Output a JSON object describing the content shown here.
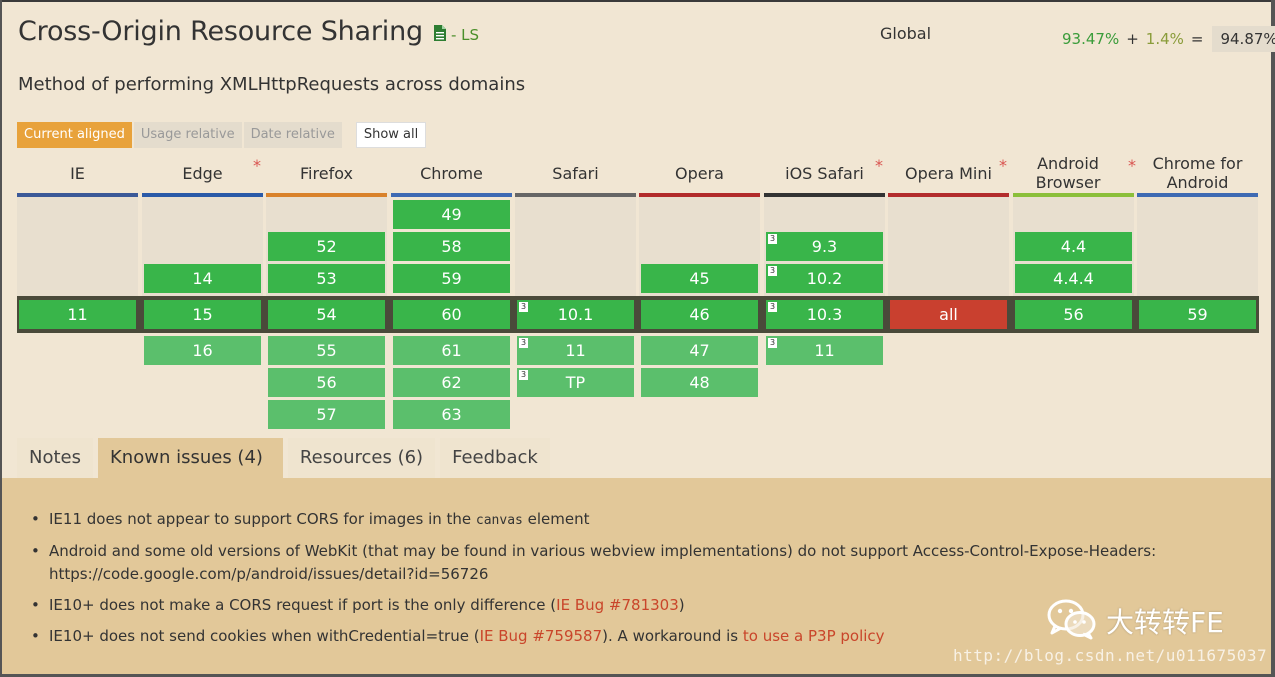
{
  "header": {
    "title": "Cross-Origin Resource Sharing",
    "spec_badge": "- LS",
    "description": "Method of performing XMLHttpRequests across domains"
  },
  "usage": {
    "scope": "Global",
    "full": "93.47%",
    "plus": "+",
    "partial": "1.4%",
    "equals": "=",
    "total": "94.87%"
  },
  "modes": {
    "current": "Current aligned",
    "usage": "Usage relative",
    "date": "Date relative",
    "show_all": "Show all"
  },
  "browsers": [
    {
      "name": "IE",
      "asterisk": ""
    },
    {
      "name": "Edge",
      "asterisk": "*"
    },
    {
      "name": "Firefox",
      "asterisk": ""
    },
    {
      "name": "Chrome",
      "asterisk": ""
    },
    {
      "name": "Safari",
      "asterisk": ""
    },
    {
      "name": "Opera",
      "asterisk": ""
    },
    {
      "name": "iOS Safari",
      "asterisk": "*"
    },
    {
      "name": "Opera Mini",
      "asterisk": "*"
    },
    {
      "name": "Android Browser",
      "asterisk": "*"
    },
    {
      "name": "Chrome for Android",
      "asterisk": ""
    }
  ],
  "browser_colors": [
    "#3b5998",
    "#2a5aa8",
    "#d9822b",
    "#3e6ab3",
    "#666666",
    "#b22b2b",
    "#333333",
    "#b32d2d",
    "#8bbf3a",
    "#3e6ab3"
  ],
  "versions": {
    "ie": {
      "current": "11"
    },
    "edge": {
      "past": [
        "14"
      ],
      "current": "15",
      "future": [
        "16"
      ]
    },
    "firefox": {
      "past": [
        "52",
        "53"
      ],
      "current": "54",
      "future": [
        "55",
        "56",
        "57"
      ]
    },
    "chrome": {
      "past": [
        "49",
        "58",
        "59"
      ],
      "current": "60",
      "future": [
        "61",
        "62",
        "63"
      ]
    },
    "safari": {
      "current": "10.1",
      "future": [
        "11",
        "TP"
      ]
    },
    "opera": {
      "past": [
        "45"
      ],
      "current": "46",
      "future": [
        "47",
        "48"
      ]
    },
    "ios_safari": {
      "past": [
        "9.3",
        "10.2"
      ],
      "current": "10.3",
      "future": [
        "11"
      ]
    },
    "opera_mini": {
      "current": "all"
    },
    "android": {
      "past": [
        "4.4",
        "4.4.4"
      ],
      "current": "56"
    },
    "chrome_android": {
      "current": "59"
    },
    "note_marker": "3"
  },
  "tabs": {
    "notes": "Notes",
    "known_issues": "Known issues (4)",
    "resources": "Resources (6)",
    "feedback": "Feedback"
  },
  "issues": {
    "i1_a": "IE11 does not appear to support CORS for images in the ",
    "i1_code": "canvas",
    "i1_b": " element",
    "i2_a": "Android and some old versions of WebKit (that may be found in various webview implementations) do not support Access-Control-Expose-Headers:",
    "i2_b": "https://code.google.com/p/android/issues/detail?id=56726",
    "i3_a": "IE10+ does not make a CORS request if port is the only difference (",
    "i3_link": "IE Bug #781303",
    "i3_b": ")",
    "i4_a": "IE10+ does not send cookies when withCredential=true (",
    "i4_link": "IE Bug #759587",
    "i4_b": "). A workaround is ",
    "i4_link2": "to use a P3P policy"
  },
  "overlay": {
    "wechat_name": "大转转FE",
    "watermark": "http://blog.csdn.net/u011675037"
  }
}
